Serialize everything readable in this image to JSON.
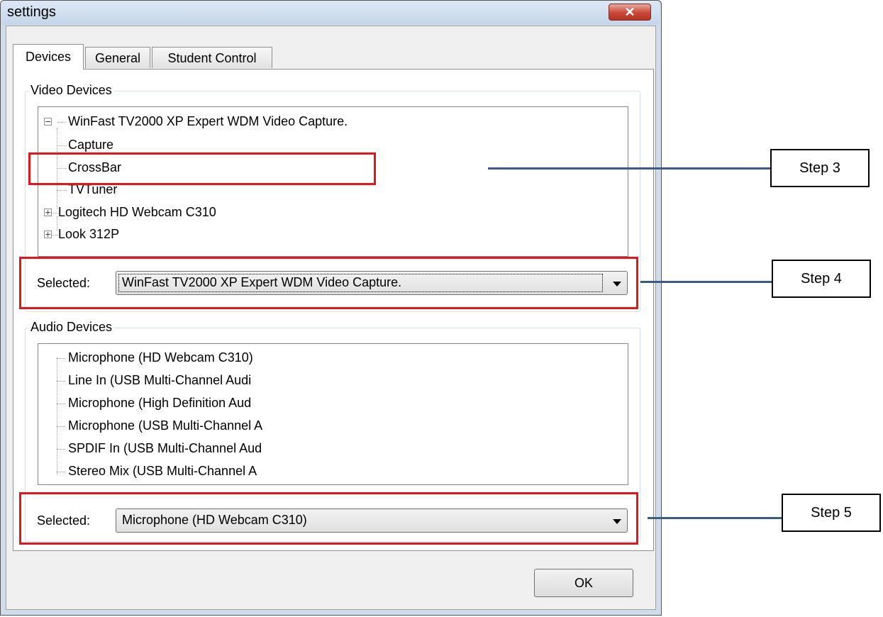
{
  "window": {
    "title": "settings",
    "close_symbol": "✕"
  },
  "tabs": [
    {
      "label": "Devices",
      "active": true
    },
    {
      "label": "General",
      "active": false
    },
    {
      "label": "Student Control",
      "active": false
    }
  ],
  "video": {
    "group_label": "Video Devices",
    "tree": {
      "root": "WinFast TV2000 XP Expert WDM Video Capture.",
      "children": [
        "Capture",
        "CrossBar",
        "TVTuner"
      ],
      "siblings": [
        "Logitech HD Webcam C310",
        "Look 312P"
      ]
    },
    "selected_label": "Selected:",
    "selected_value": "WinFast TV2000 XP Expert WDM Video Capture."
  },
  "audio": {
    "group_label": "Audio Devices",
    "items": [
      "Microphone (HD Webcam C310)",
      "Line In (USB Multi-Channel Audi",
      "Microphone (High Definition Aud",
      "Microphone (USB Multi-Channel A",
      "SPDIF In (USB Multi-Channel Aud",
      "Stereo Mix (USB Multi-Channel A"
    ],
    "selected_label": "Selected:",
    "selected_value": "Microphone (HD Webcam C310)"
  },
  "ok_label": "OK",
  "annotations": {
    "step3": "Step 3",
    "step4": "Step 4",
    "step5": "Step 5"
  },
  "colors": {
    "highlight_red": "#e0171d",
    "connector_blue": "#3b5d84"
  }
}
